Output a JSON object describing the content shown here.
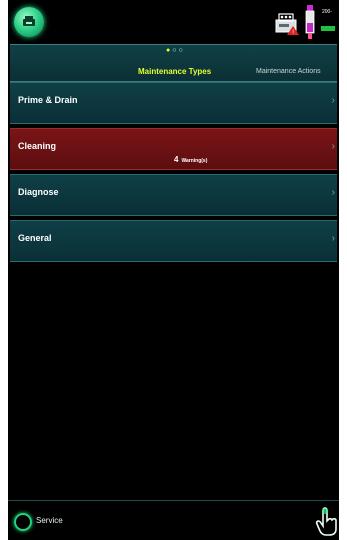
{
  "header": {
    "ink_label": "200-",
    "icons": [
      "app-logo-icon",
      "printer-icon",
      "ink-cartridge-icon",
      "ink-level-icon"
    ]
  },
  "tabs": {
    "active_label": "Maintenance Types",
    "inactive_label": "Maintenance Actions",
    "dots": [
      "●",
      "○",
      "○"
    ]
  },
  "menu": {
    "items": [
      {
        "label": "Prime & Drain"
      },
      {
        "label": "Cleaning",
        "warning_count": "4",
        "warning_text": "Warning(s)"
      },
      {
        "label": "Diagnose"
      },
      {
        "label": "General"
      }
    ],
    "chevron": "›"
  },
  "footer": {
    "service_label": "Service"
  },
  "colors": {
    "accent": "#e3ff2d",
    "item_bg": "#0f3f47",
    "warning_bg": "#7a1417",
    "green": "#23d27d"
  }
}
